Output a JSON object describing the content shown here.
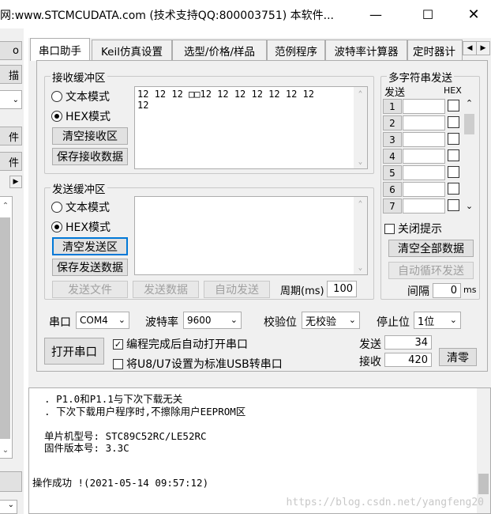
{
  "window": {
    "title": "网:www.STCMCUDATA.com  (技术支持QQ:800003751) 本软件...",
    "minimize_icon": "minimize-icon",
    "maximize_icon": "maximize-icon",
    "close_icon": "close-icon"
  },
  "left_strip": {
    "items": [
      "o",
      "描",
      "",
      "件",
      "件"
    ]
  },
  "tabs": [
    "串口助手",
    "Keil仿真设置",
    "选型/价格/样品",
    "范例程序",
    "波特率计算器",
    "定时器计"
  ],
  "receive": {
    "group_label": "接收缓冲区",
    "text_mode": "文本模式",
    "hex_mode": "HEX模式",
    "clear_button": "清空接收区",
    "save_button": "保存接收数据",
    "content_line1": "12 12 12 □□12 12 12 12 12 12 12",
    "content_line2": "12"
  },
  "send": {
    "group_label": "发送缓冲区",
    "text_mode": "文本模式",
    "hex_mode": "HEX模式",
    "clear_button": "清空发送区",
    "save_button": "保存发送数据",
    "send_file_button": "发送文件",
    "send_data_button": "发送数据",
    "auto_send_button": "自动发送",
    "period_label": "周期(ms)",
    "period_value": "100"
  },
  "multi_string": {
    "group_label": "多字符串发送",
    "col_send": "发送",
    "col_hex": "HEX",
    "rows": [
      "1",
      "2",
      "3",
      "4",
      "5",
      "6",
      "7"
    ],
    "close_hint_label": "关闭提示",
    "clear_all_button": "清空全部数据",
    "auto_loop_button": "自动循环发送",
    "interval_label": "间隔",
    "interval_value": "0",
    "interval_unit": "ms"
  },
  "port": {
    "port_label": "串口",
    "port_value": "COM4",
    "baud_label": "波特率",
    "baud_value": "9600",
    "parity_label": "校验位",
    "parity_value": "无校验",
    "stop_label": "停止位",
    "stop_value": "1位",
    "open_button": "打开串口",
    "auto_open_label": "编程完成后自动打开串口",
    "usb_label": "将U8/U7设置为标准USB转串口",
    "send_count_label": "发送",
    "send_count": "34",
    "recv_count_label": "接收",
    "recv_count": "420",
    "clear_button": "清零"
  },
  "log": {
    "lines": [
      "  . P1.0和P1.1与下次下载无关",
      "  . 下次下载用户程序时,不擦除用户EEPROM区",
      "",
      "",
      "  单片机型号: STC89C52RC/LE52RC",
      "  固件版本号: 3.3C",
      "",
      "",
      "操作成功 !(2021-05-14 09:57:12)"
    ],
    "watermark": "https://blog.csdn.net/yangfeng20"
  }
}
